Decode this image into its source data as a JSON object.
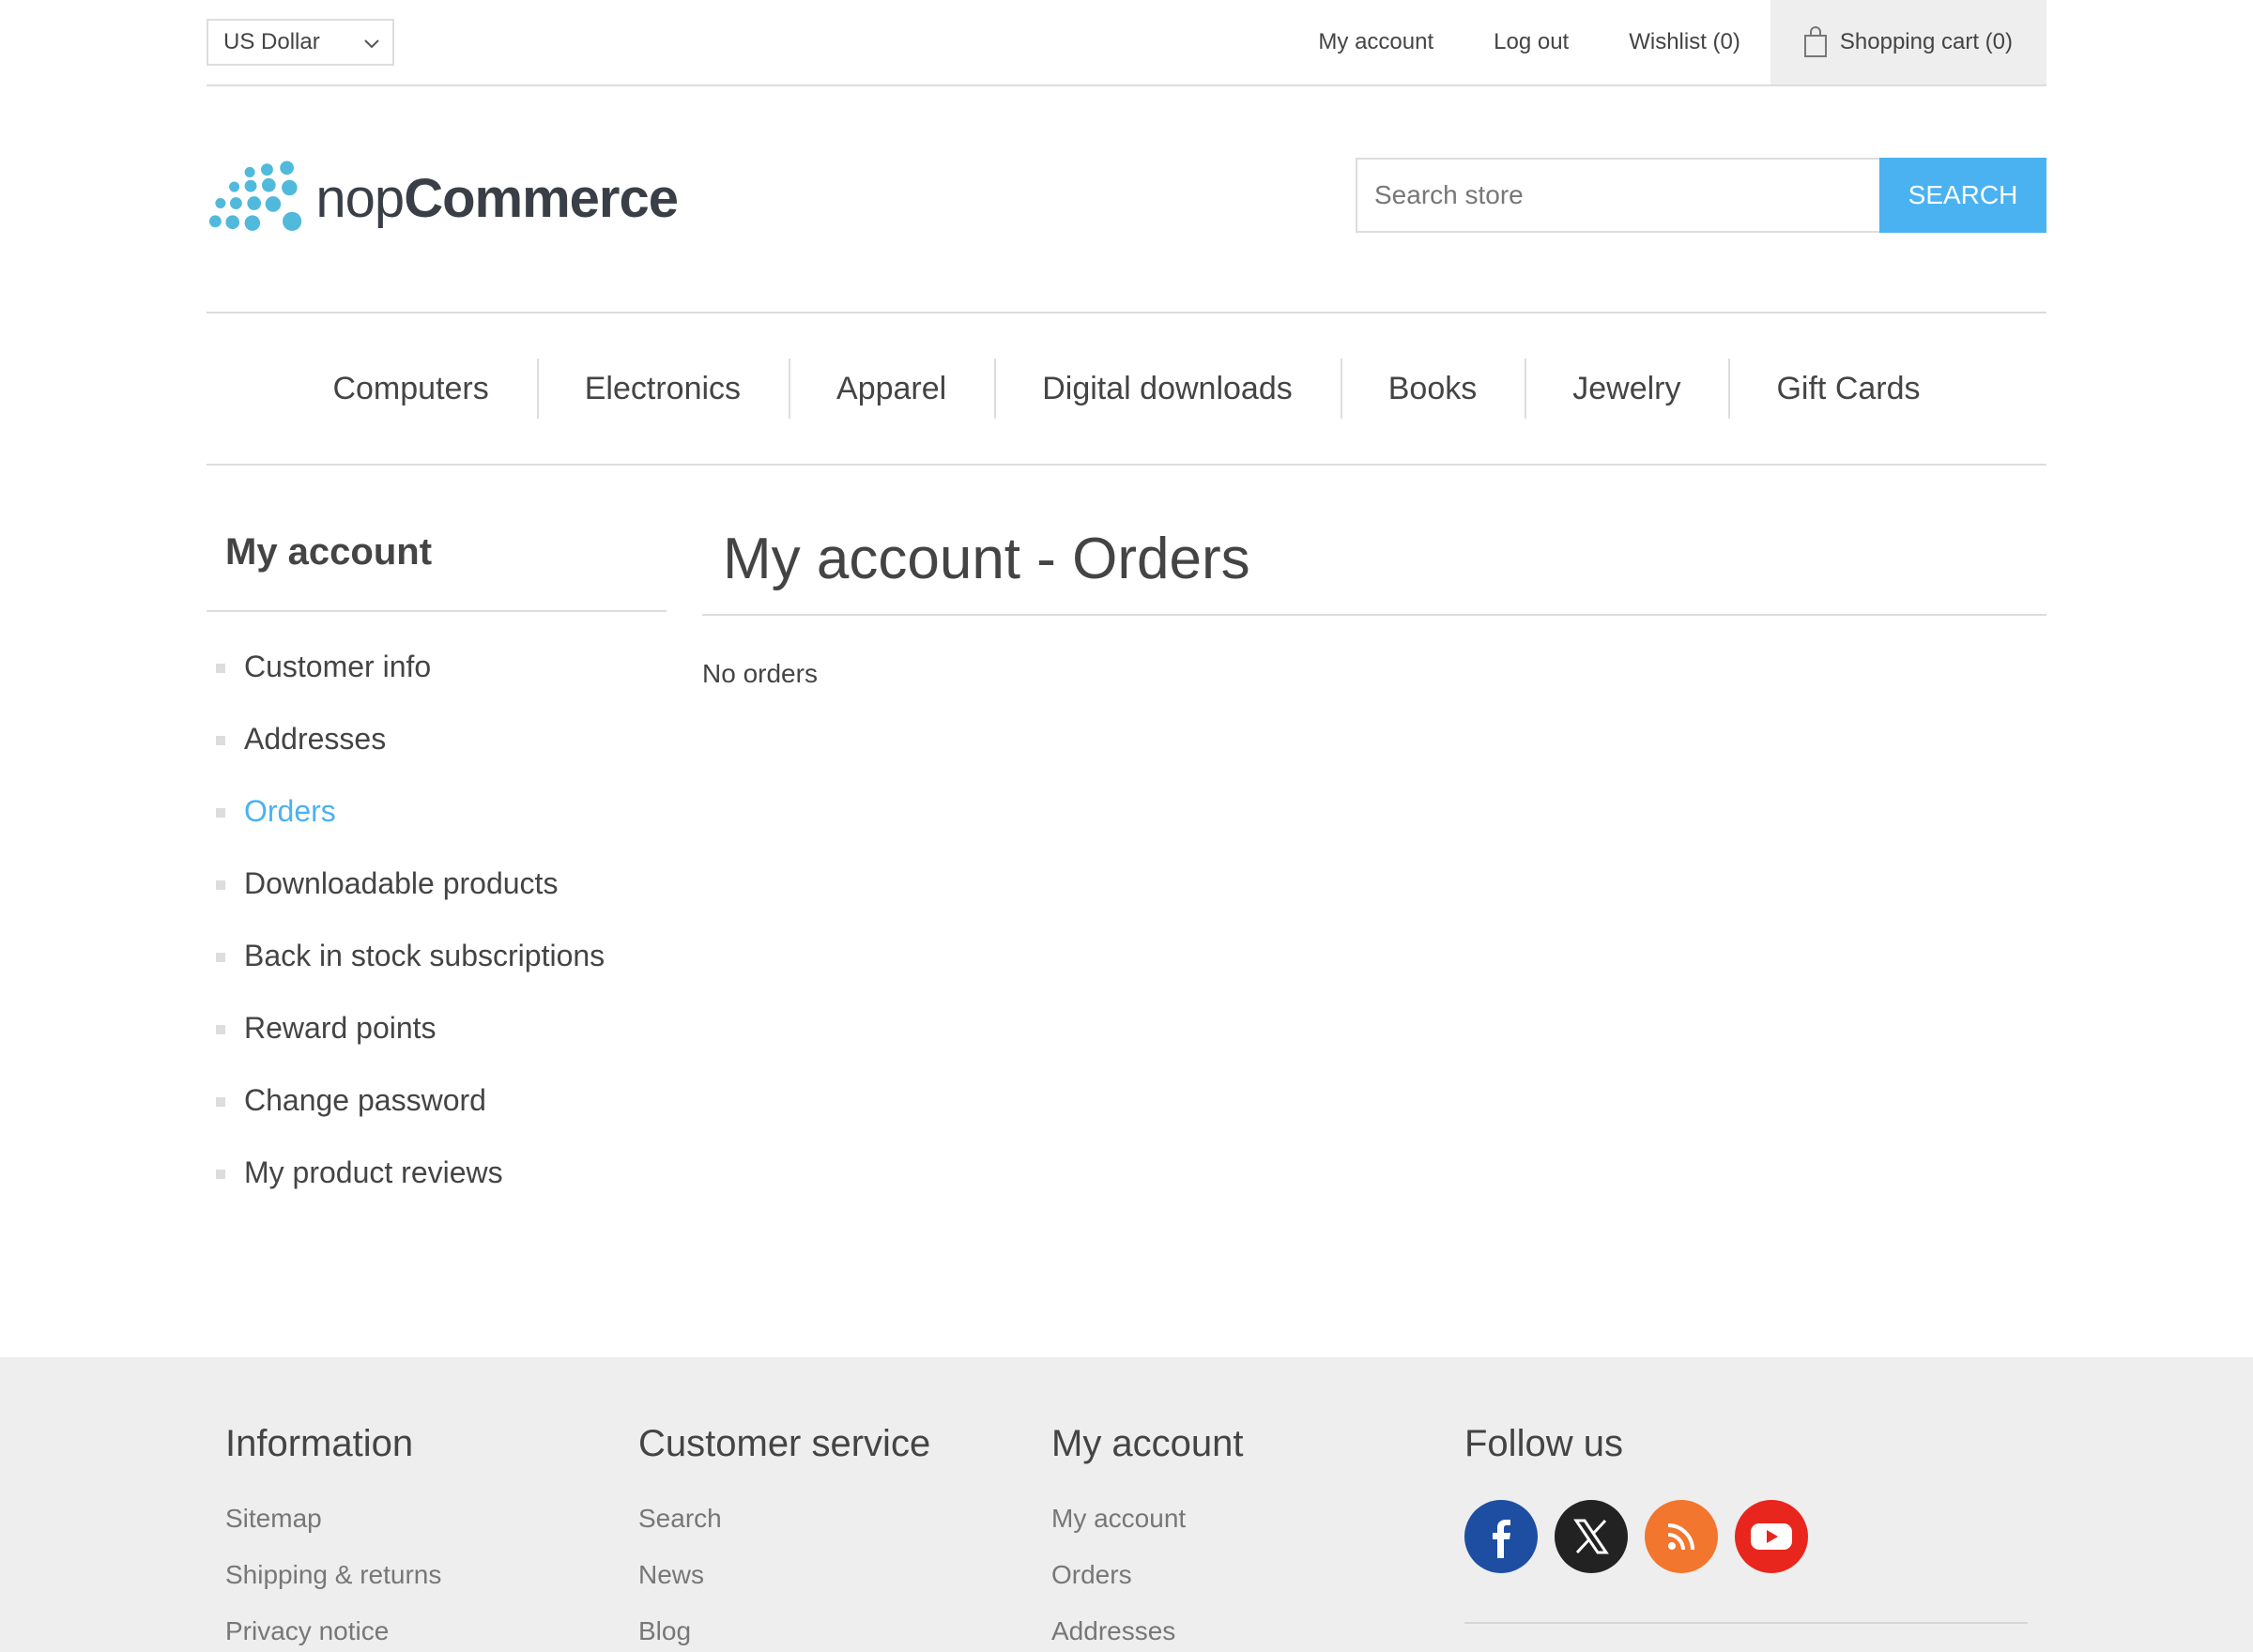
{
  "header": {
    "currency": "US Dollar",
    "links": [
      "My account",
      "Log out",
      "Wishlist (0)"
    ],
    "cart": "Shopping cart (0)"
  },
  "logo": {
    "prefix": "nop",
    "suffix": "Commerce"
  },
  "search": {
    "placeholder": "Search store",
    "button": "SEARCH"
  },
  "top_menu": [
    "Computers",
    "Electronics",
    "Apparel",
    "Digital downloads",
    "Books",
    "Jewelry",
    "Gift Cards"
  ],
  "sidebar": {
    "title": "My account",
    "items": [
      {
        "label": "Customer info"
      },
      {
        "label": "Addresses"
      },
      {
        "label": "Orders",
        "active": true
      },
      {
        "label": "Downloadable products"
      },
      {
        "label": "Back in stock subscriptions"
      },
      {
        "label": "Reward points"
      },
      {
        "label": "Change password"
      },
      {
        "label": "My product reviews"
      }
    ]
  },
  "main": {
    "title": "My account - Orders",
    "empty_message": "No orders"
  },
  "footer": {
    "information": {
      "title": "Information",
      "links": [
        "Sitemap",
        "Shipping & returns",
        "Privacy notice"
      ]
    },
    "customer_service": {
      "title": "Customer service",
      "links": [
        "Search",
        "News",
        "Blog"
      ]
    },
    "my_account": {
      "title": "My account",
      "links": [
        "My account",
        "Orders",
        "Addresses"
      ]
    },
    "follow_us": {
      "title": "Follow us",
      "icons": [
        "facebook-icon",
        "x-icon",
        "rss-icon",
        "youtube-icon"
      ]
    }
  },
  "colors": {
    "accent": "#4ab2f1",
    "text": "#444444",
    "footer_bg": "#eeeeee",
    "border": "#dddddd"
  }
}
